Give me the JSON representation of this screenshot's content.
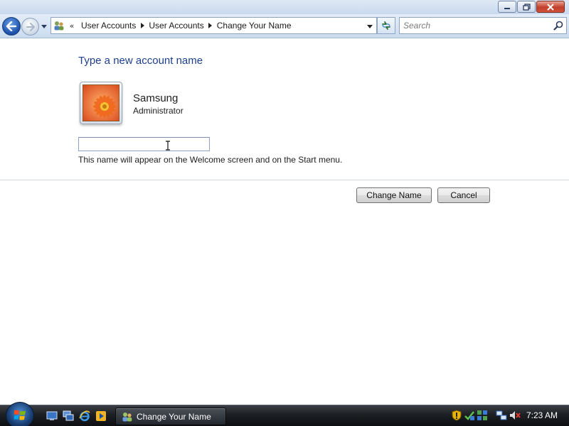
{
  "window": {
    "title": "Change Your Name",
    "caption_buttons": [
      "minimize-icon",
      "restore-icon",
      "close-icon"
    ]
  },
  "navigation": {
    "back_icon": "back-arrow-icon",
    "forward_icon": "forward-arrow-icon",
    "breadcrumb_overflow": "«",
    "breadcrumbs": [
      "User Accounts",
      "User Accounts",
      "Change Your Name"
    ],
    "refresh_icon": "refresh-icon"
  },
  "search": {
    "placeholder": "Search",
    "value": ""
  },
  "main": {
    "heading": "Type a new account name",
    "user": {
      "name": "Samsung",
      "role": "Administrator",
      "avatar_icon": "flower-avatar-icon"
    },
    "name_input": {
      "value": "",
      "placeholder": ""
    },
    "hint": "This name will appear on the Welcome screen and on the Start menu.",
    "buttons": {
      "change_name": "Change Name",
      "cancel": "Cancel"
    }
  },
  "taskbar": {
    "start_icon": "windows-logo-icon",
    "quick_launch": [
      "show-desktop-icon",
      "switch-windows-icon",
      "internet-explorer-icon",
      "media-player-icon"
    ],
    "active_task": {
      "label": "Change Your Name",
      "icon": "user-accounts-icon"
    },
    "tray_icons": [
      "security-alert-icon",
      "windows-update-icon",
      "network-status-icon",
      "network-icon",
      "volume-muted-icon"
    ],
    "clock": "7:23 AM"
  },
  "colors": {
    "heading": "#1e3f8c",
    "nav_background": "#cbdcf0",
    "taskbar": "#1c1f23",
    "close_button": "#c2402b"
  }
}
